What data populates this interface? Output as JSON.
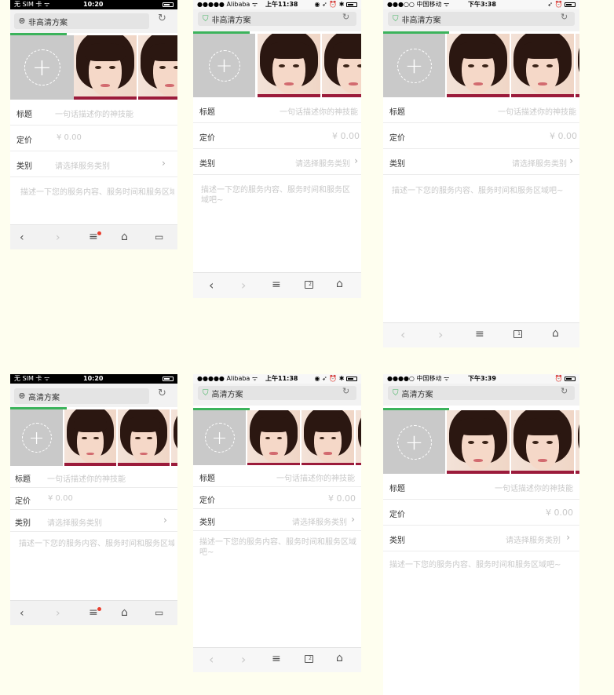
{
  "phones": [
    {
      "status": {
        "carrier": "无 SIM 卡 ᯤ",
        "time": "10:20",
        "extra": ""
      },
      "url_label": "非高清方案",
      "form": {
        "title_label": "标题",
        "title_placeholder": "一句话描述你的神技能",
        "price_label": "定价",
        "price_placeholder": "¥ 0.00",
        "category_label": "类别",
        "category_placeholder": "请选择服务类别",
        "desc_placeholder": "描述一下您的服务内容、服务时间和服务区域吧~"
      }
    },
    {
      "status": {
        "carrier": "●●●●● Alibaba ᯤ",
        "time": "上午11:38",
        "extra": "◉ ➶ ⏰ ✱"
      },
      "url_label": "非高清方案",
      "form": {
        "title_label": "标题",
        "title_placeholder": "一句话描述你的神技能",
        "price_label": "定价",
        "price_placeholder": "¥ 0.00",
        "category_label": "类别",
        "category_placeholder": "请选择服务类别",
        "desc_placeholder": "描述一下您的服务内容、服务时间和服务区域吧~"
      },
      "tab_count": "2"
    },
    {
      "status": {
        "carrier": "●●●○○ 中国移动 ᯤ",
        "time": "下午3:38",
        "extra": "➶ ⏰"
      },
      "url_label": "非高清方案",
      "form": {
        "title_label": "标题",
        "title_placeholder": "一句话描述你的神技能",
        "price_label": "定价",
        "price_placeholder": "¥ 0.00",
        "category_label": "类别",
        "category_placeholder": "请选择服务类别",
        "desc_placeholder": "描述一下您的服务内容、服务时间和服务区域吧~"
      },
      "tab_count": "1"
    },
    {
      "status": {
        "carrier": "无 SIM 卡 ᯤ",
        "time": "10:20",
        "extra": ""
      },
      "url_label": "高清方案",
      "form": {
        "title_label": "标题",
        "title_placeholder": "一句话描述你的神技能",
        "price_label": "定价",
        "price_placeholder": "¥ 0.00",
        "category_label": "类别",
        "category_placeholder": "请选择服务类别",
        "desc_placeholder": "描述一下您的服务内容、服务时间和服务区域吧~"
      }
    },
    {
      "status": {
        "carrier": "●●●●● Alibaba ᯤ",
        "time": "上午11:38",
        "extra": "◉ ➶ ⏰ ✱"
      },
      "url_label": "高清方案",
      "form": {
        "title_label": "标题",
        "title_placeholder": "一句话描述你的神技能",
        "price_label": "定价",
        "price_placeholder": "¥ 0.00",
        "category_label": "类别",
        "category_placeholder": "请选择服务类别",
        "desc_placeholder": "描述一下您的服务内容、服务时间和服务区域吧~"
      },
      "tab_count": "2"
    },
    {
      "status": {
        "carrier": "●●●●○ 中国移动 ᯤ",
        "time": "下午3:39",
        "extra": "⏰"
      },
      "url_label": "高清方案",
      "form": {
        "title_label": "标题",
        "title_placeholder": "一句话描述你的神技能",
        "price_label": "定价",
        "price_placeholder": "¥ 0.00",
        "category_label": "类别",
        "category_placeholder": "请选择服务类别",
        "desc_placeholder": "描述一下您的服务内容、服务时间和服务区域吧~"
      }
    }
  ],
  "icons": {
    "globe": "globe-icon",
    "shield": "shield-icon",
    "reload": "reload-icon",
    "back": "back-icon",
    "forward": "forward-icon",
    "menu": "menu-icon",
    "home": "home-icon",
    "tabs": "tabs-icon",
    "add": "add-photo-icon",
    "chevron": "chevron-right-icon"
  },
  "colors": {
    "accent_green": "#3bb35b",
    "placeholder_gray": "#c9c9c9",
    "notification_red": "#ea3f2e",
    "backdrop": "#fefeef"
  }
}
